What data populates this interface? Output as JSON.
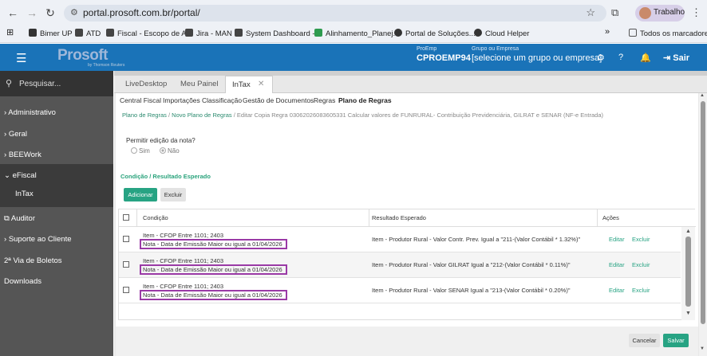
{
  "browser": {
    "url": "portal.prosoft.com.br/portal/",
    "profile": "Trabalho",
    "bookmarks": [
      "Bimer UP",
      "ATD",
      "Fiscal - Escopo de A...",
      "Jira - MAN",
      "System Dashboard -...",
      "Alinhamento_Planej...",
      "Portal de Soluções...",
      "Cloud Helper"
    ],
    "all_bookmarks": "Todos os marcadores",
    "more": "»"
  },
  "header": {
    "logo": "Prosoft",
    "logo_sub": "by Thomson Reuters",
    "emp_label": "ProEmp",
    "emp_value": "CPROEMP94",
    "group_label": "Grupo ou Empresa",
    "group_value": "[selecione um grupo ou empresa]",
    "logout": "Sair"
  },
  "sidebar": {
    "search_placeholder": "Pesquisar...",
    "items": [
      "Administrativo",
      "Geral",
      "BEEWork",
      "eFiscal",
      "InTax",
      "Auditor",
      "Suporte ao Cliente",
      "2ª Via de Boletos",
      "Downloads"
    ]
  },
  "tabs": [
    "LiveDesktop",
    "Meu Painel",
    "InTax"
  ],
  "subnav": [
    "Central Fiscal",
    "Importações",
    "Classificação",
    "Gestão de Documentos",
    "Regras",
    "Plano de Regras"
  ],
  "breadcrumb": {
    "items": [
      "Plano de Regras",
      "Novo Plano de Regras",
      "Editar Copia Regra 03062026083605331 Calcular valores de FUNRURAL- Contribuição Previdenciária, GILRAT e SENAR (NF-e Entrada)"
    ],
    "sep": "/"
  },
  "form": {
    "permit_label": "Permitir edição da nota?",
    "opt_yes": "Sim",
    "opt_no": "Não",
    "section_title": "Condição / Resultado Esperado",
    "add": "Adicionar",
    "delete": "Excluir"
  },
  "grid": {
    "columns": [
      "Condição",
      "Resultado Esperado",
      "Ações"
    ],
    "rows": [
      {
        "cond1": "Item - CFOP Entre 1101; 2403",
        "cond2": "Nota - Data de Emissão Maior ou igual a 01/04/2026",
        "result": "Item - Produtor Rural - Valor Contr. Prev. Igual a \"211-(Valor Contábil * 1.32%)\"",
        "edit": "Editar",
        "del": "Excluir"
      },
      {
        "cond1": "Item - CFOP Entre 1101; 2403",
        "cond2": "Nota - Data de Emissão Maior ou igual a 01/04/2026",
        "result": "Item - Produtor Rural - Valor GILRAT Igual a \"212-(Valor Contábil * 0.11%)\"",
        "edit": "Editar",
        "del": "Excluir"
      },
      {
        "cond1": "Item - CFOP Entre 1101; 2403",
        "cond2": "Nota - Data de Emissão Maior ou igual a 01/04/2026",
        "result": "Item - Produtor Rural - Valor SENAR Igual a \"213-(Valor Contábil * 0.20%)\"",
        "edit": "Editar",
        "del": "Excluir"
      }
    ]
  },
  "footer": {
    "cancel": "Cancelar",
    "save": "Salvar"
  },
  "colors": {
    "header": "#1a73b8",
    "accent": "#27a383",
    "highlight": "#9a3aa6",
    "sidebar": "#555555"
  }
}
